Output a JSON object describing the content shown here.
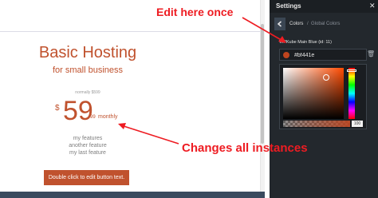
{
  "preview": {
    "title": "Basic Hosting",
    "subtitle": "for small business",
    "normally": "normally $599",
    "currency": "$",
    "amount": "59",
    "cents": "99",
    "period": "monthly",
    "features": [
      "my features",
      "another feature",
      "my last feature"
    ],
    "cta_label": "Double click to edit button text."
  },
  "annotations": {
    "top": "Edit here once",
    "bottom": "Changes all instances"
  },
  "panel": {
    "title": "Settings",
    "close_icon": "close-icon",
    "tabs": {
      "current": "Colors",
      "separator": "/",
      "next": "Global Colors"
    },
    "color_label": "WPKube Main Blue (id: 11)",
    "hex_value": "#bf441e",
    "alpha_value": "100"
  },
  "colors": {
    "accent": "#bf441e",
    "annotation": "#ee1c22",
    "panel_bg": "#23282d"
  }
}
